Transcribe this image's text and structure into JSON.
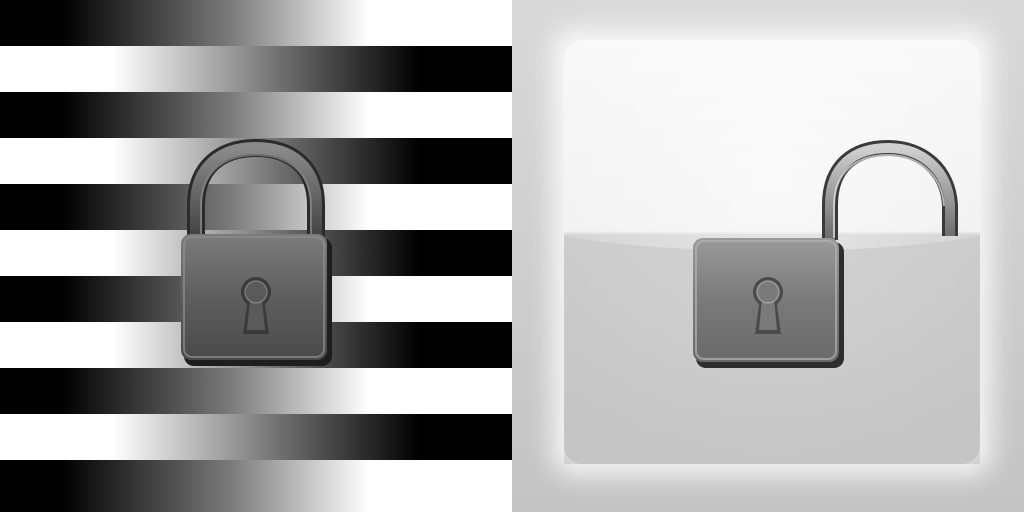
{
  "panels": [
    {
      "id": "locked",
      "icon": "padlock-closed-icon",
      "background": "striped-gradient"
    },
    {
      "id": "unlocked",
      "icon": "padlock-open-icon",
      "background": "glossy-gray-tile"
    }
  ],
  "colors": {
    "stripe_dark": "#000000",
    "stripe_light": "#ffffff",
    "lock_body": "#6e6e6e",
    "lock_shadow": "#2a2a2a",
    "tile_light": "#f2f2f2",
    "tile_mid": "#c9c9c9"
  }
}
